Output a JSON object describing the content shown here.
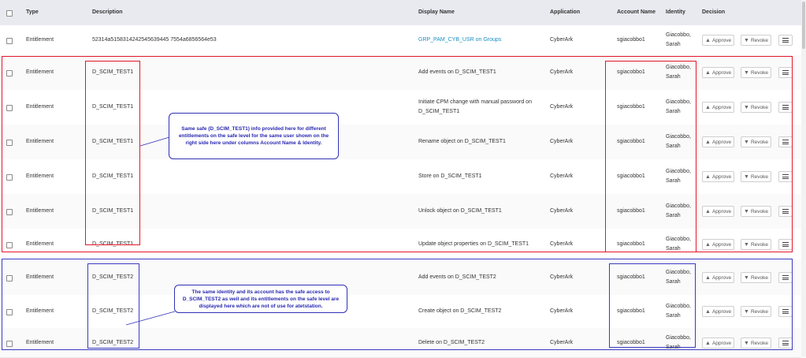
{
  "columns": {
    "type": "Type",
    "description": "Description",
    "display_name": "Display Name",
    "application": "Application",
    "account_name": "Account Name",
    "identity": "Identity",
    "decision": "Decision"
  },
  "buttons": {
    "approve": "Approve",
    "revoke": "Revoke"
  },
  "rows": [
    {
      "type": "Entitlement",
      "description": "52314a5158314242545639445 7554a6856564e53",
      "display_name": "GRP_PAM_CYB_USR on Groups",
      "application": "CyberArk",
      "account_name": "sgiacobbo1",
      "identity_first": "Giacobbo,",
      "identity_last": "Sarah"
    },
    {
      "type": "Entitlement",
      "description": "D_SCIM_TEST1",
      "display_name": "Add events on D_SCIM_TEST1",
      "application": "CyberArk",
      "account_name": "sgiacobbo1",
      "identity_first": "Giacobbo,",
      "identity_last": "Sarah"
    },
    {
      "type": "Entitlement",
      "description": "D_SCIM_TEST1",
      "display_name": "Initiate CPM change with manual password on",
      "display_name_2": "D_SCIM_TEST1",
      "application": "CyberArk",
      "account_name": "sgiacobbo1",
      "identity_first": "Giacobbo,",
      "identity_last": "Sarah"
    },
    {
      "type": "Entitlement",
      "description": "D_SCIM_TEST1",
      "display_name": "Rename object on D_SCIM_TEST1",
      "application": "CyberArk",
      "account_name": "sgiacobbo1",
      "identity_first": "Giacobbo,",
      "identity_last": "Sarah"
    },
    {
      "type": "Entitlement",
      "description": "D_SCIM_TEST1",
      "display_name": "Store on D_SCIM_TEST1",
      "application": "CyberArk",
      "account_name": "sgiacobbo1",
      "identity_first": "Giacobbo,",
      "identity_last": "Sarah"
    },
    {
      "type": "Entitlement",
      "description": "D_SCIM_TEST1",
      "display_name": "Unlock object on D_SCIM_TEST1",
      "application": "CyberArk",
      "account_name": "sgiacobbo1",
      "identity_first": "Giacobbo,",
      "identity_last": "Sarah"
    },
    {
      "type": "Entitlement",
      "description": "D_SCIM_TEST1",
      "display_name": "Update object properties on D_SCIM_TEST1",
      "application": "CyberArk",
      "account_name": "sgiacobbo1",
      "identity_first": "Giacobbo,",
      "identity_last": "Sarah"
    },
    {
      "type": "Entitlement",
      "description": "D_SCIM_TEST2",
      "display_name": "Add events on D_SCIM_TEST2",
      "application": "CyberArk",
      "account_name": "sgiacobbo1",
      "identity_first": "Giacobbo,",
      "identity_last": "Sarah"
    },
    {
      "type": "Entitlement",
      "description": "D_SCIM_TEST2",
      "display_name": "Create object on D_SCIM_TEST2",
      "application": "CyberArk",
      "account_name": "sgiacobbo1",
      "identity_first": "Giacobbo,",
      "identity_last": "Sarah"
    },
    {
      "type": "Entitlement",
      "description": "D_SCIM_TEST2",
      "display_name": "Delete on D_SCIM_TEST2",
      "application": "CyberArk",
      "account_name": "sgiacobbo1",
      "identity_first": "Giacobbo,",
      "identity_last": "Sarah"
    }
  ],
  "annotations": {
    "callout_1": "Same safe (D_SCIM_TEST1) info provided here for different entitlements on the safe level for the same user shown on the right side here under columns Account Name & Identity.",
    "callout_2": "The same identity and its account has the safe access to D_SCIM_TEST2 as well and its entitlements on the safe level are displayed here which are not of use for atetstation.",
    "color_red": "#e3172a",
    "color_blue": "#3a3ac0"
  }
}
